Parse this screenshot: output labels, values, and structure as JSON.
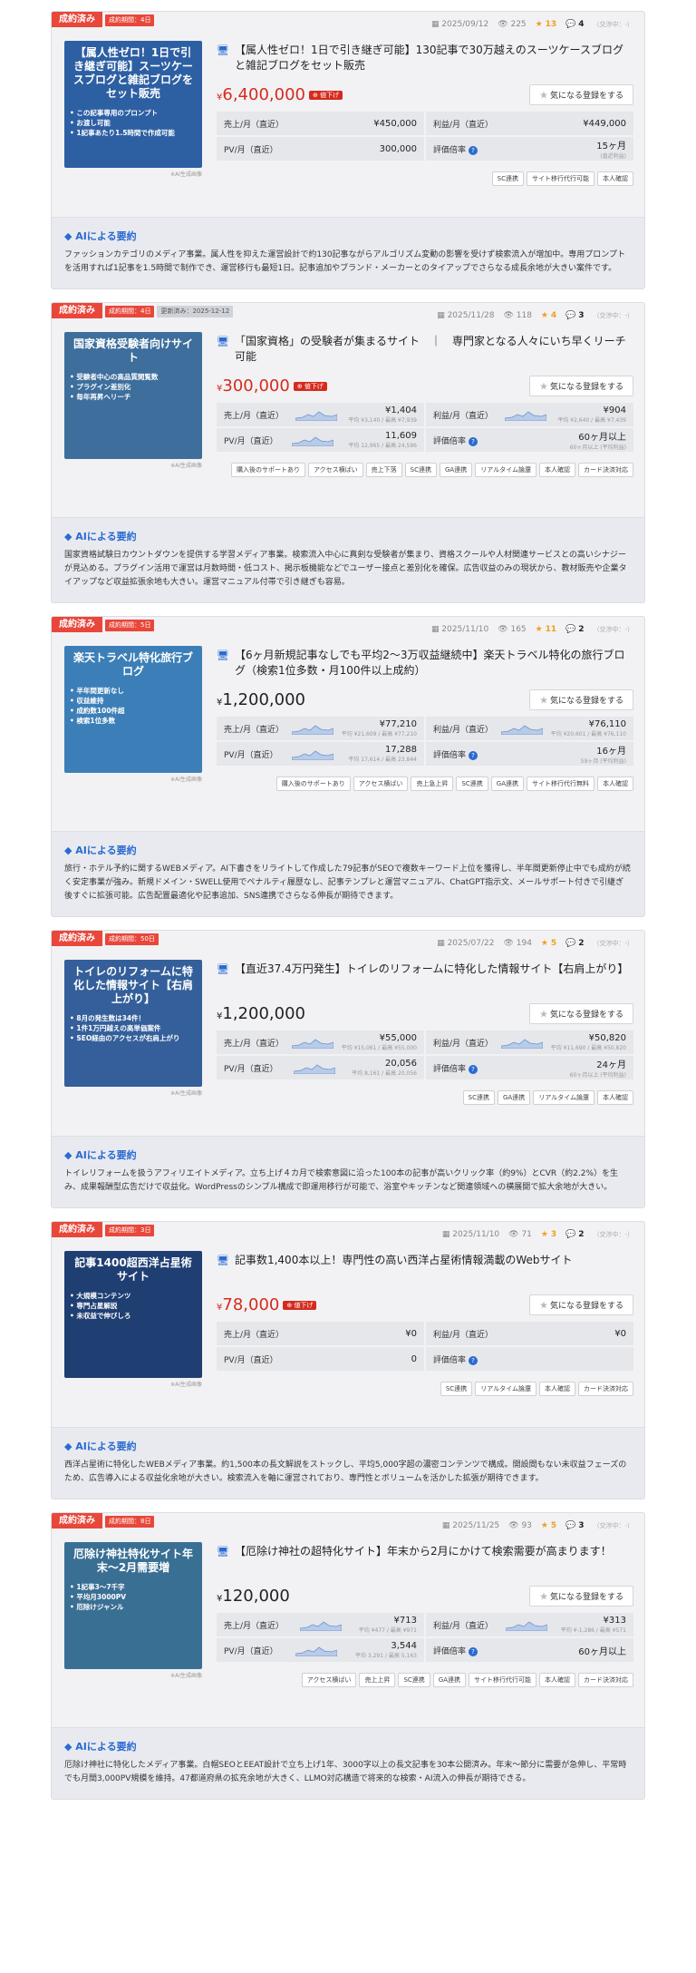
{
  "common": {
    "sold_label": "成約済み",
    "ai_label": "AIによる要約",
    "fav_label": "気になる登録をする",
    "ai_caption": "※AI生成画像",
    "sales_label": "売上/月（直近）",
    "profit_label": "利益/月（直近）",
    "pv_label": "PV/月（直近）",
    "rate_label": "評価倍率",
    "down_label": "値下げ",
    "reply_suffix": "（交渉中：-）"
  },
  "listings": [
    {
      "period": "成約期間：4日",
      "date_tag": "",
      "date": "2025/09/12",
      "views": "225",
      "stars": "13",
      "comments": "4",
      "thumb_title": "【属人性ゼロ！1日で引き継ぎ可能】スーツケースブログと雑記ブログをセット販売",
      "thumb_bullets": [
        "この記事専用のプロンプト",
        "お渡し可能",
        "1記事あたり1.5時間で作成可能"
      ],
      "thumb_color": "#2d5fa3",
      "title": "【属人性ゼロ！1日で引き継ぎ可能】130記事で30万越えのスーツケースブログと雑記ブログをセット販売",
      "price": "6,400,000",
      "price_red": true,
      "down": true,
      "sales": "¥450,000",
      "sales_sub": "",
      "profit": "¥449,000",
      "profit_sub": "",
      "pv": "300,000",
      "pv_sub": "",
      "rate": "15ヶ月",
      "rate_sub": "(直近利益)",
      "chips": [
        "SC連携",
        "サイト移行代行可能",
        "本人確認"
      ],
      "summary": "ファッションカテゴリのメディア事業。属人性を抑えた運営設計で約130記事ながらアルゴリズム変動の影響を受けず検索流入が増加中。専用プロンプトを活用すれば1記事を1.5時間で制作でき、運営移行も最短1日。記事追加やブランド・メーカーとのタイアップでさらなる成長余地が大きい案件です。"
    },
    {
      "period": "成約期間：4日",
      "date_tag": "更新済み：2025-12-12",
      "date": "2025/11/28",
      "views": "118",
      "stars": "4",
      "comments": "3",
      "thumb_title": "国家資格受験者向けサイト",
      "thumb_bullets": [
        "受験者中心の高品質閲覧数",
        "プラグイン差別化",
        "毎年再昇ヘリーチ"
      ],
      "thumb_color": "#3d6e9c",
      "title": "「国家資格」の受験者が集まるサイト　｜　専門家となる人々にいち早くリーチ可能",
      "price": "300,000",
      "price_red": true,
      "down": true,
      "sales": "¥1,404",
      "sales_sub": "平均 ¥3,140 / 最高 ¥7,939",
      "profit": "¥904",
      "profit_sub": "平均 ¥2,640 / 最高 ¥7,439",
      "pv": "11,609",
      "pv_sub": "平均 12,965 / 最高 24,596",
      "rate": "60ヶ月以上",
      "rate_sub": "60ヶ月以上 (平均利益)",
      "chips": [
        "購入後のサポートあり",
        "アクセス横ばい",
        "売上下落",
        "SC連携",
        "GA連携",
        "リアルタイム論還",
        "本人確認",
        "カード決済対応"
      ],
      "summary": "国家資格試験日カウントダウンを提供する学習メディア事業。検索流入中心に真剣な受験者が集まり、資格スクールや人材関連サービスとの高いシナジーが見込める。プラグイン活用で運営は月数時間・低コスト、掲示板機能などでユーザー接点と差別化を確保。広告収益のみの現状から、教材販売や企業タイアップなど収益拡張余地も大きい。運営マニュアル付帯で引き継ぎも容易。"
    },
    {
      "period": "成約期間：5日",
      "date_tag": "",
      "date": "2025/11/10",
      "views": "165",
      "stars": "11",
      "comments": "2",
      "thumb_title": "楽天トラベル特化旅行ブログ",
      "thumb_bullets": [
        "半年間更新なし",
        "収益維持",
        "成約数100件超",
        "検索1位多数"
      ],
      "thumb_color": "#3c7fb8",
      "title": "【6ヶ月新規記事なしでも平均2〜3万収益継続中】楽天トラベル特化の旅行ブログ（検索1位多数・月100件以上成約）",
      "price": "1,200,000",
      "price_red": false,
      "down": false,
      "sales": "¥77,210",
      "sales_sub": "平均 ¥21,609 / 最高 ¥77,210",
      "profit": "¥76,110",
      "profit_sub": "平均 ¥20,601 / 最高 ¥76,110",
      "pv": "17,288",
      "pv_sub": "平均 17,614 / 最高 23,844",
      "rate": "16ヶ月",
      "rate_sub": "59ヶ月 (平均利益)",
      "chips": [
        "購入後のサポートあり",
        "アクセス横ばい",
        "売上急上昇",
        "SC連携",
        "GA連携",
        "サイト移行代行無料",
        "本人確認"
      ],
      "summary": "旅行・ホテル予約に関するWEBメディア。AI下書きをリライトして作成した79記事がSEOで複数キーワード上位を獲得し、半年間更新停止中でも成約が続く安定事業が強み。新規ドメイン・SWELL使用でペナルティ履歴なし、記事テンプレと運営マニュアル、ChatGPT指示文、メールサポート付きで引継ぎ後すぐに拡張可能。広告配置最適化や記事追加、SNS連携でさらなる伸長が期待できます。"
    },
    {
      "period": "成約期間：50日",
      "date_tag": "",
      "date": "2025/07/22",
      "views": "194",
      "stars": "5",
      "comments": "2",
      "thumb_title": "トイレのリフォームに特化した情報サイト【右肩上がり】",
      "thumb_bullets": [
        "8月の発生数は34件！",
        "1件1万円越えの高単価案件",
        "SEO経由のアクセスが右肩上がり"
      ],
      "thumb_color": "#345f9a",
      "title": "【直近37.4万円発生】トイレのリフォームに特化した情報サイト【右肩上がり】",
      "price": "1,200,000",
      "price_red": false,
      "down": false,
      "sales": "¥55,000",
      "sales_sub": "平均 ¥15,061 / 最高 ¥55,000",
      "profit": "¥50,820",
      "profit_sub": "平均 ¥11,690 / 最高 ¥50,820",
      "pv": "20,056",
      "pv_sub": "平均 8,161 / 最高 20,056",
      "rate": "24ヶ月",
      "rate_sub": "60ヶ月以上 (平均利益)",
      "chips": [
        "SC連携",
        "GA連携",
        "リアルタイム論還",
        "本人確認"
      ],
      "summary": "トイレリフォームを扱うアフィリエイトメディア。立ち上げ４カ月で検索意図に沿った100本の記事が高いクリック率（約9%）とCVR（約2.2%）を生み、成果報酬型広告だけで収益化。WordPressのシンプル構成で即運用移行が可能で、浴室やキッチンなど関連領域への横展開で拡大余地が大きい。"
    },
    {
      "period": "成約期間：3日",
      "date_tag": "",
      "date": "2025/11/10",
      "views": "71",
      "stars": "3",
      "comments": "2",
      "thumb_title": "記事1400超西洋占星術サイト",
      "thumb_bullets": [
        "大規模コンテンツ",
        "専門占星解説",
        "未収益で伸びしろ"
      ],
      "thumb_color": "#1f3f73",
      "title": "記事数1,400本以上！専門性の高い西洋占星術情報満載のWebサイト",
      "price": "78,000",
      "price_red": true,
      "down": true,
      "sales": "¥0",
      "sales_sub": "",
      "profit": "¥0",
      "profit_sub": "",
      "pv": "0",
      "pv_sub": "",
      "rate": "",
      "rate_sub": "",
      "chips": [
        "SC連携",
        "リアルタイム論還",
        "本人確認",
        "カード決済対応"
      ],
      "summary": "西洋占星術に特化したWEBメディア事業。約1,500本の長文解説をストックし、平均5,000字超の濃密コンテンツで構成。開設間もない未収益フェーズのため、広告導入による収益化余地が大きい。検索流入を軸に運営されており、専門性とボリュームを活かした拡張が期待できます。"
    },
    {
      "period": "成約期間：8日",
      "date_tag": "",
      "date": "2025/11/25",
      "views": "93",
      "stars": "5",
      "comments": "3",
      "thumb_title": "厄除け神社特化サイト年末〜2月需要増",
      "thumb_bullets": [
        "1記事3〜7千字",
        "平均月3000PV",
        "厄除けジャンル"
      ],
      "thumb_color": "#3a6f94",
      "title": "【厄除け神社の超特化サイト】年末から2月にかけて検索需要が高まります！",
      "price": "120,000",
      "price_red": false,
      "down": false,
      "sales": "¥713",
      "sales_sub": "平均 ¥477 / 最高 ¥971",
      "profit": "¥313",
      "profit_sub": "平均 ¥-1,286 / 最高 ¥571",
      "pv": "3,544",
      "pv_sub": "平均 3,291 / 最高 5,163",
      "rate": "60ヶ月以上",
      "rate_sub": "",
      "chips": [
        "アクセス横ばい",
        "売上上昇",
        "SC連携",
        "GA連携",
        "サイト移行代行可能",
        "本人確認",
        "カード決済対応"
      ],
      "summary": "厄除け神社に特化したメディア事業。白帽SEOとEEAT設計で立ち上げ1年、3000字以上の長文記事を30本公開済み。年末〜節分に需要が急伸し、平常時でも月間3,000PV規模を維持。47都道府県の拡充余地が大きく、LLMO対応構造で将来的な検索・AI流入の伸長が期待できる。"
    }
  ]
}
